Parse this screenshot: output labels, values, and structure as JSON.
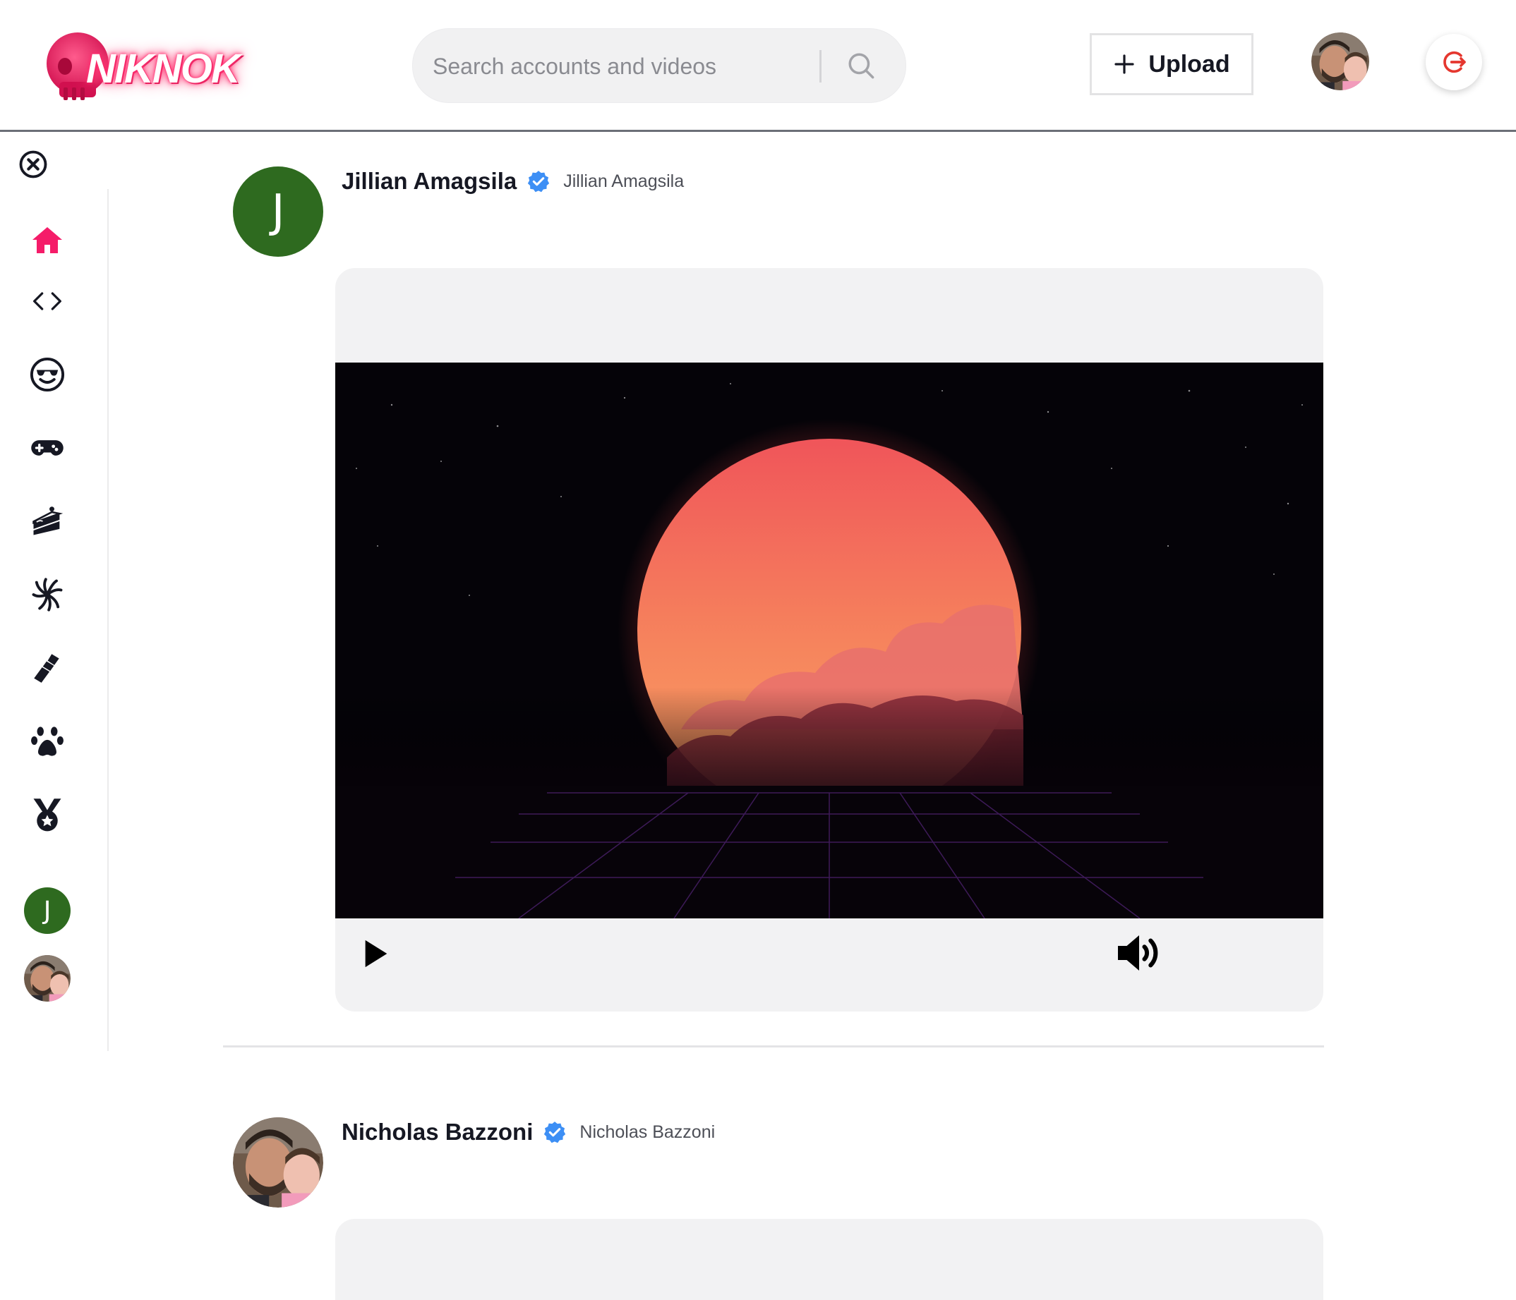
{
  "header": {
    "logo_text": "NIKNOK",
    "search": {
      "placeholder": "Search accounts and videos",
      "value": ""
    },
    "upload_label": "Upload",
    "icons": {
      "search": "search-icon",
      "upload": "plus-icon",
      "logout": "logout-icon"
    }
  },
  "sidebar": {
    "close_icon": "close-circle-icon",
    "items": [
      {
        "name": "home",
        "icon": "home-icon",
        "active": true
      },
      {
        "name": "coding",
        "icon": "code-icon"
      },
      {
        "name": "funny",
        "icon": "sunglasses-face-icon"
      },
      {
        "name": "gaming",
        "icon": "gamepad-icon"
      },
      {
        "name": "food",
        "icon": "cake-slice-icon"
      },
      {
        "name": "dance",
        "icon": "burst-icon"
      },
      {
        "name": "beauty",
        "icon": "lipstick-icon"
      },
      {
        "name": "animals",
        "icon": "paw-icon"
      },
      {
        "name": "sports",
        "icon": "medal-icon"
      }
    ],
    "accounts": [
      {
        "initial": "J"
      },
      {
        "kind": "photo"
      }
    ]
  },
  "posts": [
    {
      "author_name": "Jillian Amagsila",
      "author_nick": "Jillian Amagsila",
      "avatar_initial": "J",
      "verified": true
    },
    {
      "author_name": "Nicholas Bazzoni",
      "author_nick": "Nicholas Bazzoni",
      "verified": true
    }
  ],
  "colors": {
    "accent": "#f51c69",
    "logout": "#e5372f",
    "verified": "#3d8ff5",
    "avatar_green": "#2e6a1f",
    "card_bg": "#f2f2f3"
  }
}
